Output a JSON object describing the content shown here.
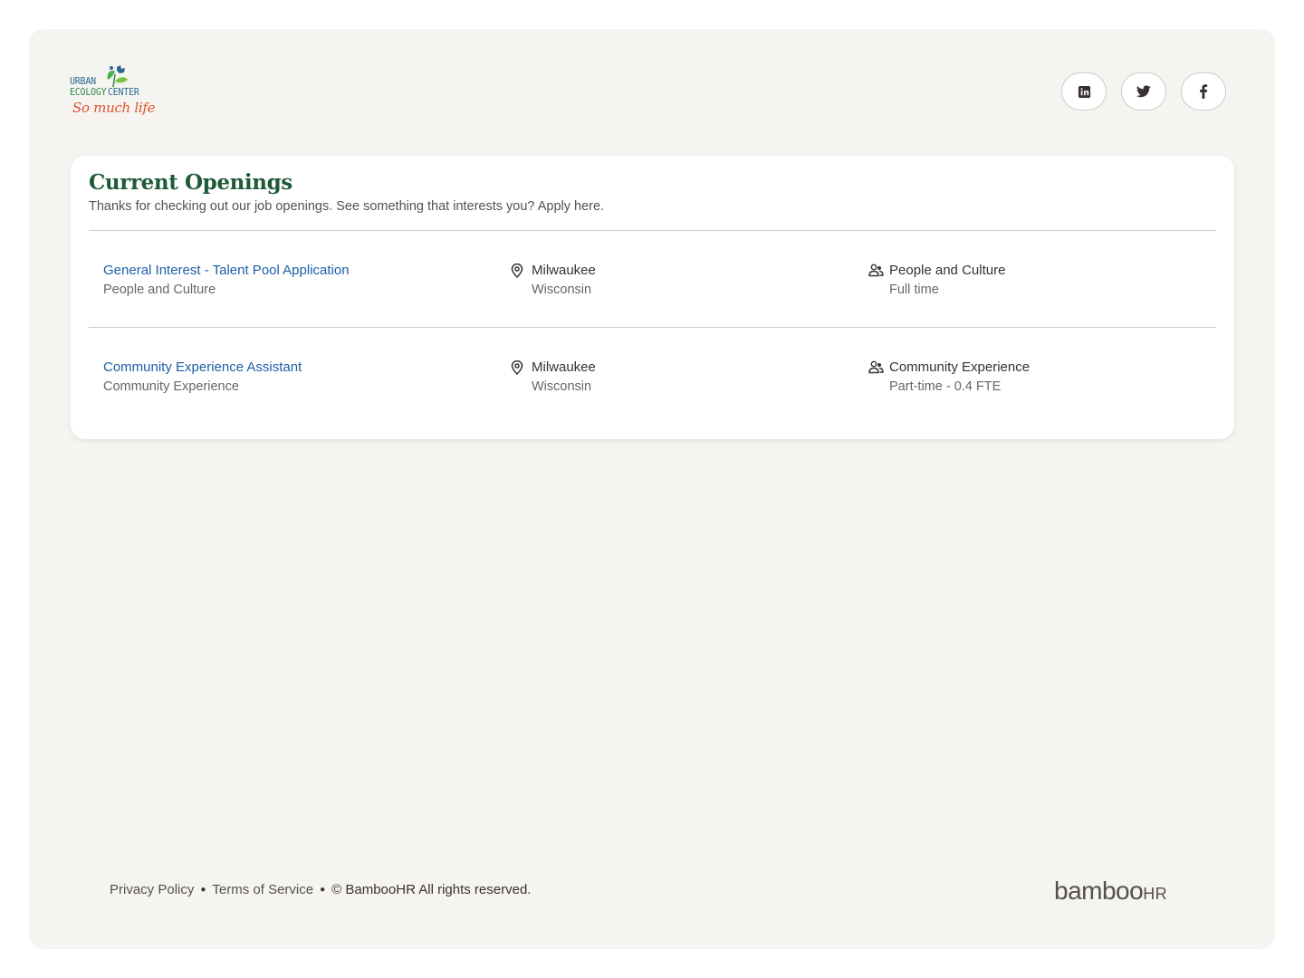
{
  "brand": {
    "logo_line1": "URBAN",
    "logo_line2": "ECOLOGY",
    "logo_line3": "CENTER",
    "tagline": "So much life"
  },
  "social": [
    {
      "name": "linkedin",
      "icon": "linkedin-icon"
    },
    {
      "name": "twitter",
      "icon": "twitter-icon"
    },
    {
      "name": "facebook",
      "icon": "facebook-icon"
    }
  ],
  "openings": {
    "title": "Current Openings",
    "subtitle": "Thanks for checking out our job openings. See something that interests you? Apply here.",
    "jobs": [
      {
        "title": "General Interest - Talent Pool Application",
        "department": "People and Culture",
        "city": "Milwaukee",
        "state": "Wisconsin",
        "team": "People and Culture",
        "type": "Full time"
      },
      {
        "title": "Community Experience Assistant",
        "department": "Community Experience",
        "city": "Milwaukee",
        "state": "Wisconsin",
        "team": "Community Experience",
        "type": "Part-time - 0.4 FTE"
      }
    ]
  },
  "footer": {
    "privacy": "Privacy Policy",
    "terms": "Terms of Service",
    "copyright": "© BambooHR All rights reserved.",
    "powered_logo_main": "bamboo",
    "powered_logo_suffix": "HR"
  },
  "colors": {
    "accent_green": "#1f5a37",
    "link_blue": "#1d5fa8",
    "page_bg": "#f5f4f1"
  }
}
